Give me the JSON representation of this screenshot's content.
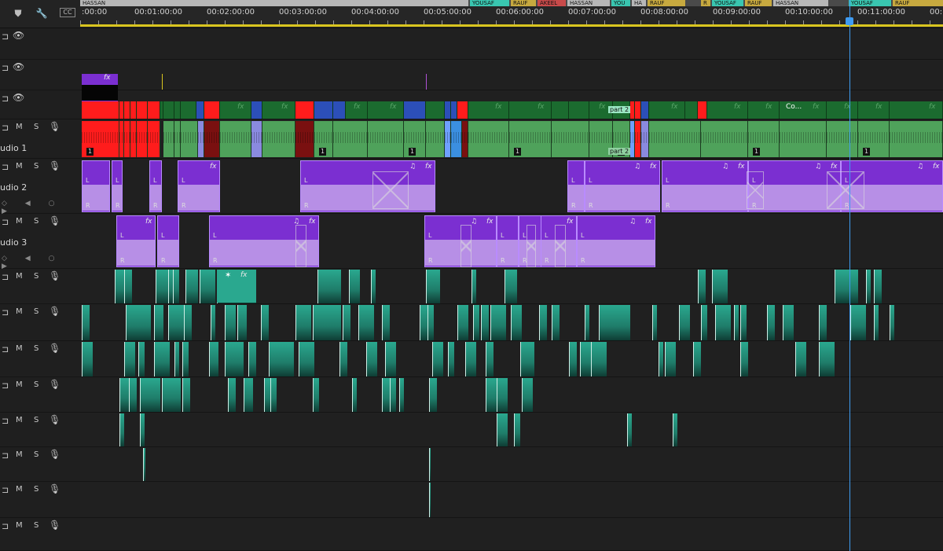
{
  "toolbar": {
    "icons": [
      "marker-icon",
      "wrench-icon",
      "captions-icon"
    ],
    "captions_label": "CC"
  },
  "ruler": {
    "markers": [
      {
        "label": "HASSAN",
        "color": "#b7b7b7"
      },
      {
        "label": "YOUSAF",
        "color": "#39c6b0"
      },
      {
        "label": "RAUF",
        "color": "#c7a93f"
      },
      {
        "label": "AKEEL",
        "color": "#c84a4a"
      },
      {
        "label": "HASSAN",
        "color": "#b7b7b7"
      },
      {
        "label": "YOU",
        "color": "#39c6b0"
      },
      {
        "label": "HA",
        "color": "#b7b7b7"
      },
      {
        "label": "RAUF",
        "color": "#c7a93f"
      },
      {
        "label": "R",
        "color": "#c7a93f"
      },
      {
        "label": "YOUSAF",
        "color": "#39c6b0"
      },
      {
        "label": "RAUF",
        "color": "#c7a93f"
      },
      {
        "label": "HASSAN",
        "color": "#b7b7b7"
      },
      {
        "label": "YOUSAF",
        "color": "#39c6b0"
      },
      {
        "label": "RAUF",
        "color": "#c7a93f"
      }
    ],
    "timecodes": [
      ":00:00",
      "00:01:00:00",
      "00:02:00:00",
      "00:03:00:00",
      "00:04:00:00",
      "00:05:00:00",
      "00:06:00:00",
      "00:07:00:00",
      "00:08:00:00",
      "00:09:00:00",
      "00:10:00:00",
      "00:11:00:00",
      "00:"
    ]
  },
  "tracks": [
    {
      "id": "v3",
      "type": "video"
    },
    {
      "id": "v2",
      "type": "video"
    },
    {
      "id": "v1",
      "type": "video"
    },
    {
      "id": "a1",
      "type": "audio",
      "name": "udio 1"
    },
    {
      "id": "a2",
      "type": "audio",
      "name": "udio 2"
    },
    {
      "id": "a3",
      "type": "audio",
      "name": "udio 3"
    },
    {
      "id": "a4",
      "type": "audio"
    },
    {
      "id": "a5",
      "type": "audio"
    },
    {
      "id": "a6",
      "type": "audio"
    },
    {
      "id": "a7",
      "type": "audio"
    },
    {
      "id": "a8",
      "type": "audio"
    },
    {
      "id": "a9",
      "type": "audio"
    },
    {
      "id": "a10",
      "type": "audio"
    },
    {
      "id": "a11",
      "type": "audio"
    }
  ],
  "labels": {
    "mute": "M",
    "solo": "S",
    "fx": "fx",
    "one": "1",
    "l": "L",
    "r": "R",
    "part": "part 2",
    "co": "Co...",
    "music": "♫"
  },
  "colors": {
    "video_green": "#1b6b2f",
    "audio_green": "#4fa25b",
    "red": "#ff1c1c",
    "blue": "#2c4fb8",
    "purple": "#7b2fd1",
    "teal": "#2aa88f",
    "playhead": "#3f9cf2",
    "yellow": "#d9c51f"
  }
}
